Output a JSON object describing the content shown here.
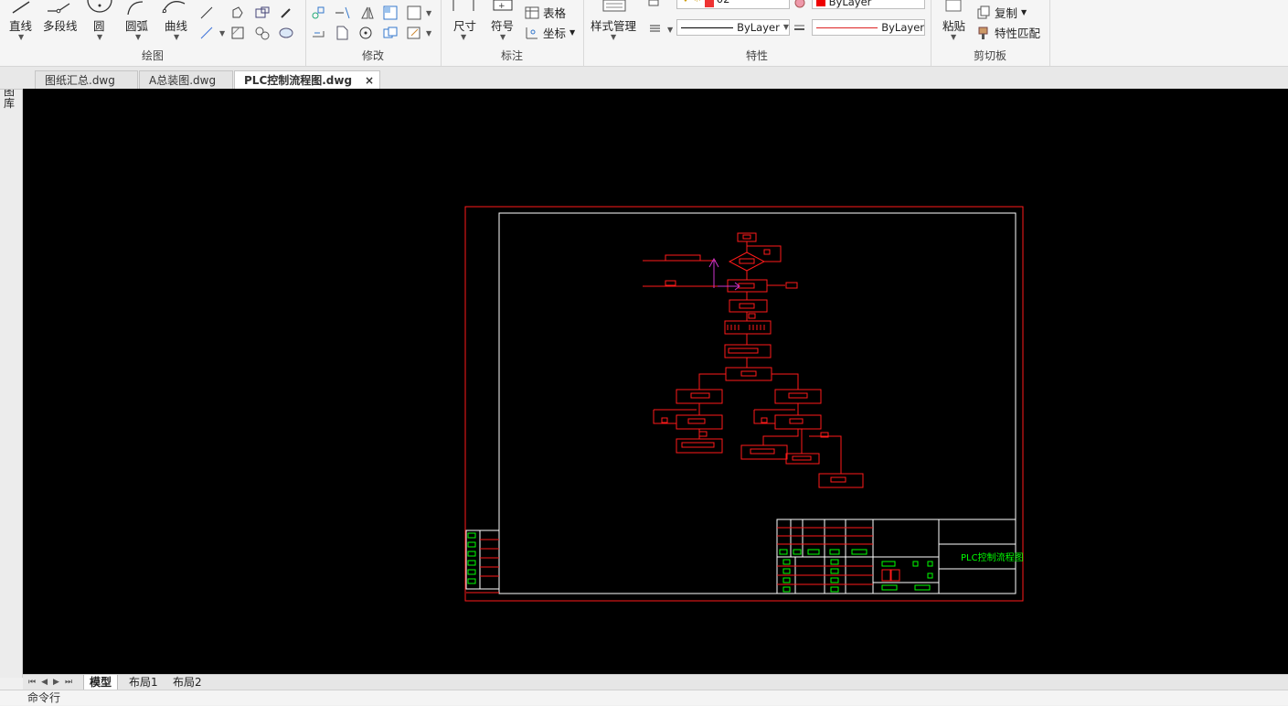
{
  "ribbon": {
    "draw": {
      "label": "绘图",
      "line": "直线",
      "polyline": "多段线",
      "circle": "圆",
      "arc": "圆弧",
      "curve": "曲线"
    },
    "modify": {
      "label": "修改"
    },
    "annotate": {
      "label": "标注",
      "dimension": "尺寸",
      "symbol": "符号",
      "table": "表格",
      "coordinate": "坐标"
    },
    "style": {
      "style_manager": "样式管理"
    },
    "properties": {
      "label": "特性",
      "layer_value": "02",
      "color_value": "ByLayer",
      "linetype_value": "ByLayer",
      "lineweight_value": "ByLayer"
    },
    "clipboard": {
      "label": "剪切板",
      "paste": "粘贴",
      "copy": "复制",
      "match_properties": "特性匹配"
    }
  },
  "tabs": [
    {
      "label": "图纸汇总.dwg"
    },
    {
      "label": "A总装图.dwg"
    },
    {
      "label": "PLC控制流程图.dwg"
    }
  ],
  "side_panel": {
    "label": "图库"
  },
  "layouts": [
    "模型",
    "布局1",
    "布局2"
  ],
  "drawing": {
    "title_text": "PLC控制流程图"
  },
  "command_line": {
    "label": "命令行"
  },
  "colors": {
    "canvas": "#000000",
    "red_line": "#ff1a1a",
    "white_line": "#ffffff",
    "green_text": "#00ff00",
    "magenta": "#cc33cc"
  }
}
